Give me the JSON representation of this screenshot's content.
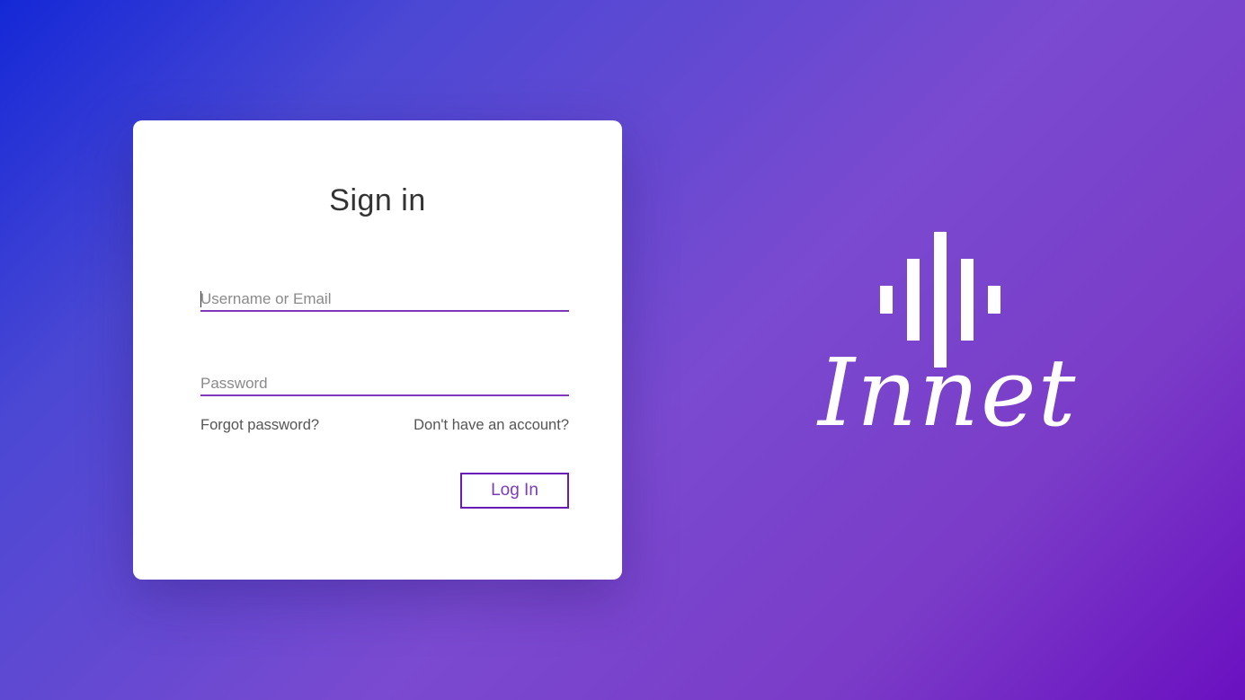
{
  "signin": {
    "title": "Sign in",
    "username_placeholder": "Username or Email",
    "password_placeholder": "Password",
    "forgot_label": "Forgot password?",
    "signup_label": "Don't have an account?",
    "login_label": "Log In"
  },
  "brand": {
    "name": "Innet",
    "icon": "sound-bars-icon"
  },
  "colors": {
    "accent": "#7c3aba",
    "button_border": "#6a1cb8",
    "background_start": "#1428d6",
    "background_end": "#6a10c0",
    "card": "#ffffff"
  }
}
